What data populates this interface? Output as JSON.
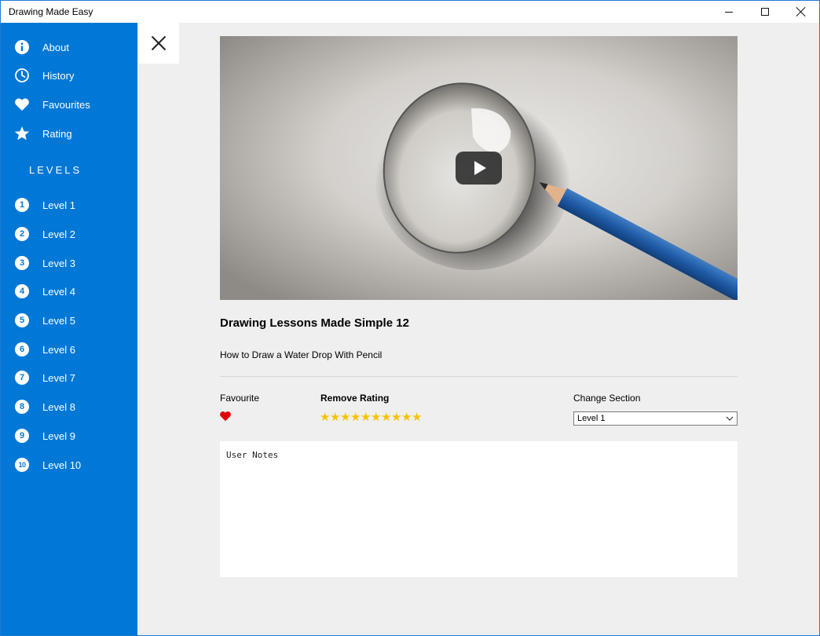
{
  "window": {
    "title": "Drawing Made Easy"
  },
  "sidebar": {
    "menu": [
      {
        "label": "About",
        "icon": "info-icon"
      },
      {
        "label": "History",
        "icon": "clock-icon"
      },
      {
        "label": "Favourites",
        "icon": "heart-icon"
      },
      {
        "label": "Rating",
        "icon": "star-icon"
      }
    ],
    "levels_header": "LEVELS",
    "levels": [
      {
        "num": "1",
        "label": "Level 1"
      },
      {
        "num": "2",
        "label": "Level 2"
      },
      {
        "num": "3",
        "label": "Level 3"
      },
      {
        "num": "4",
        "label": "Level 4"
      },
      {
        "num": "5",
        "label": "Level 5"
      },
      {
        "num": "6",
        "label": "Level 6"
      },
      {
        "num": "7",
        "label": "Level 7"
      },
      {
        "num": "8",
        "label": "Level 8"
      },
      {
        "num": "9",
        "label": "Level 9"
      },
      {
        "num": "10",
        "label": "Level 10"
      }
    ],
    "accent_color": "#0178d6"
  },
  "lesson": {
    "title": "Drawing Lessons Made Simple 12",
    "description": "How to Draw a Water Drop With Pencil",
    "favourite_label": "Favourite",
    "favourite_icon": "heart-icon",
    "favourite_color": "#e00000",
    "rating_label": "Remove Rating",
    "rating_stars": 10,
    "star_color": "#f5c400",
    "section_label": "Change Section",
    "section_selected": "Level 1",
    "notes_placeholder": "User Notes"
  }
}
